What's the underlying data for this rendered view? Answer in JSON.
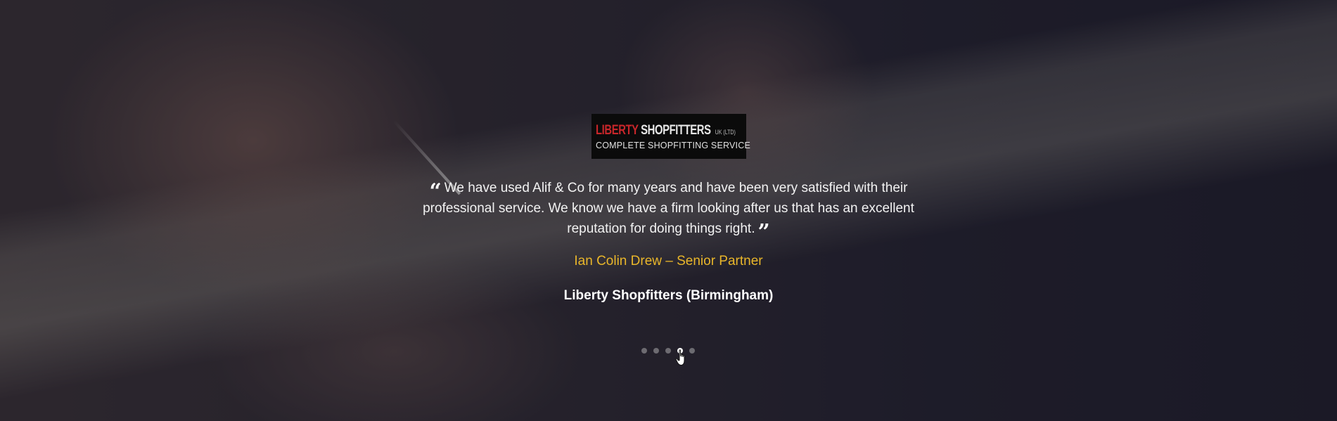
{
  "logo": {
    "word1": "LIBERTY",
    "word2": "SHOPFITTERS",
    "suffix": "UK (LTD)",
    "tagline": "COMPLETE SHOPFITTING SERVICE"
  },
  "testimonial": {
    "quote": "We have used Alif & Co for many years and have been very satisfied with their professional service. We know we have a firm looking after us that has an excellent reputation for doing things right.",
    "author": "Ian Colin Drew – Senior Partner",
    "company": "Liberty Shopfitters (Birmingham)"
  },
  "carousel": {
    "slide_count": 5,
    "active_index": 3
  },
  "colors": {
    "author": "#e9b62a",
    "logo_accent": "#c8262a",
    "dot_active": "#ffffff"
  },
  "icons": {
    "quote_open": "quote-open-icon",
    "quote_close": "quote-close-icon",
    "cursor": "hand-pointer-icon"
  }
}
